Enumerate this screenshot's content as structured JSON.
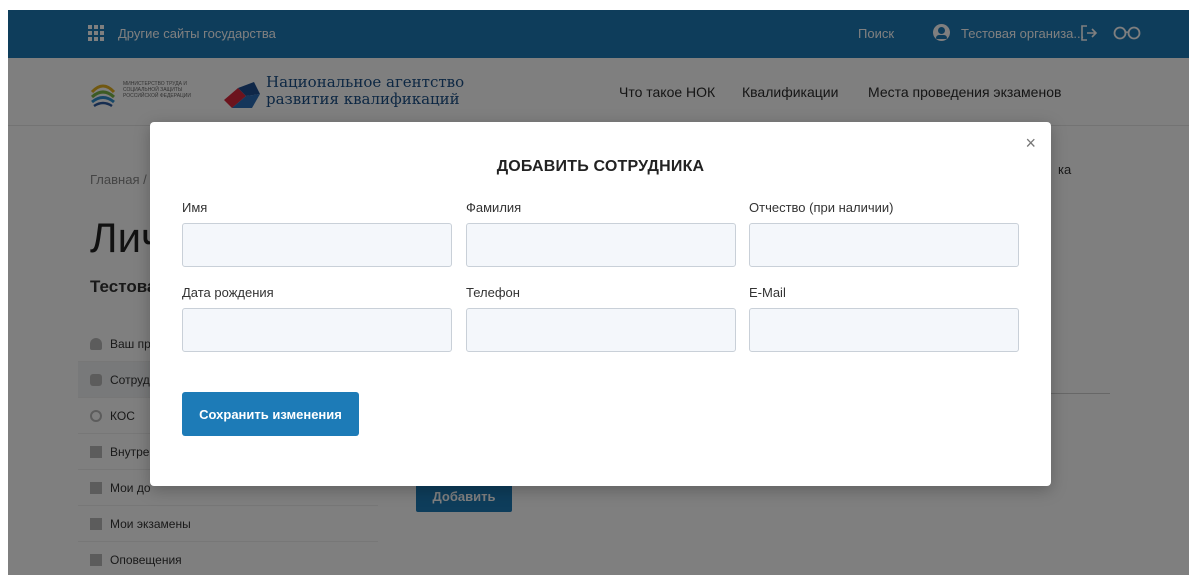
{
  "topbar": {
    "other_sites": "Другие сайты государства",
    "search": "Поиск",
    "org_name": "Тестовая организа...",
    "icons": [
      "grid-icon",
      "user-icon",
      "logout-icon",
      "glasses-icon"
    ]
  },
  "header": {
    "ministry_text": "Министерство труда и социальной защиты Российской Федерации",
    "agency_name": "Национальное агентство развития квалификаций",
    "nav": [
      "Что такое НОК",
      "Квалификации",
      "Места проведения экзаменов"
    ]
  },
  "page": {
    "breadcrumb": "Главная /",
    "title": "Лич",
    "org_title": "Тестова",
    "right_text": "ка",
    "add_button": "Добавить",
    "side_menu": [
      {
        "label": "Ваш пр",
        "icon": "person-icon"
      },
      {
        "label": "Сотруд",
        "icon": "group-icon"
      },
      {
        "label": "КОС",
        "icon": "cos-icon"
      },
      {
        "label": "Внутре",
        "icon": "library-icon"
      },
      {
        "label": "Мои до",
        "icon": "document-icon"
      },
      {
        "label": "Мои экзамены",
        "icon": "exam-icon"
      },
      {
        "label": "Оповещения",
        "icon": "notification-icon"
      }
    ]
  },
  "modal": {
    "title": "ДОБАВИТЬ СОТРУДНИКА",
    "close": "×",
    "fields": {
      "first_name": {
        "label": "Имя",
        "value": ""
      },
      "last_name": {
        "label": "Фамилия",
        "value": ""
      },
      "patronymic": {
        "label": "Отчество (при наличии)",
        "value": ""
      },
      "birth_date": {
        "label": "Дата рождения",
        "value": ""
      },
      "phone": {
        "label": "Телефон",
        "value": ""
      },
      "email": {
        "label": "E-Mail",
        "value": ""
      }
    },
    "save_button": "Сохранить изменения"
  },
  "colors": {
    "primary": "#1d7bb7",
    "overlay": "rgba(0,0,0,0.5)",
    "input_bg": "#f4f7fb"
  }
}
